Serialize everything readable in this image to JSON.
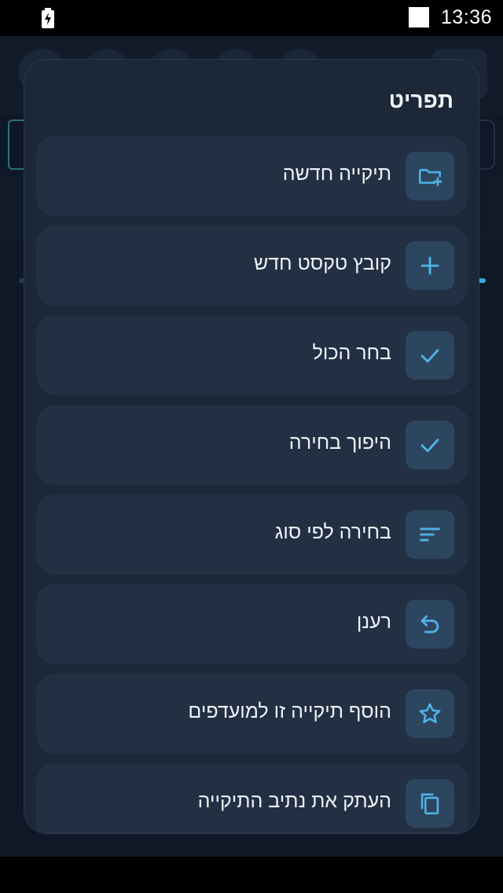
{
  "status_bar": {
    "time": "13:36",
    "battery_icon": "battery-charging-icon",
    "sim_icon": "sim-icon"
  },
  "menu": {
    "title": "תפריט",
    "items": [
      {
        "label": "תיקייה חדשה",
        "icon": "create-folder-icon"
      },
      {
        "label": "קובץ טקסט חדש",
        "icon": "plus-icon"
      },
      {
        "label": "בחר הכול",
        "icon": "check-icon"
      },
      {
        "label": "היפוך בחירה",
        "icon": "check-icon"
      },
      {
        "label": "בחירה לפי סוג",
        "icon": "sort-lines-icon"
      },
      {
        "label": "רענן",
        "icon": "undo-arrow-icon"
      },
      {
        "label": "הוסף תיקייה זו למועדפים",
        "icon": "star-outline-icon"
      },
      {
        "label": "העתק את נתיב התיקייה",
        "icon": "copy-icon"
      }
    ]
  },
  "colors": {
    "dialog_bg": "#1c2838",
    "item_bg": "#232f42",
    "icon_box_bg": "#2d4660",
    "icon_accent": "#4fb3e8",
    "text": "#eef3f8"
  }
}
